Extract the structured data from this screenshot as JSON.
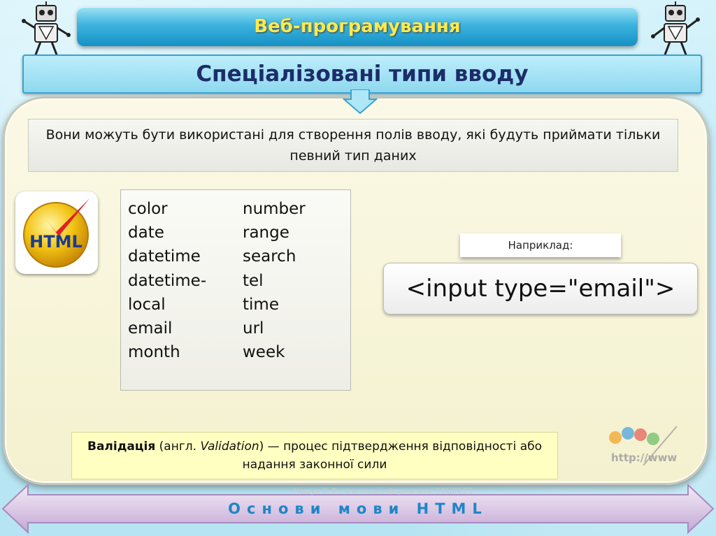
{
  "header": {
    "title": "Веб-програмування"
  },
  "slide": {
    "heading": "Спеціалізовані типи вводу",
    "description": "Вони можуть бути використані для створення полів вводу, які будуть приймати тільки певний тип даних",
    "logo_text": "HTML",
    "types_col1": [
      "color",
      "date",
      "datetime",
      "datetime-",
      "local",
      "email",
      "month"
    ],
    "types_col2": [
      "number",
      "range",
      "search",
      "tel",
      "time",
      "url",
      "week"
    ],
    "example_label": "Наприклад:",
    "example_code": "<input type=\"email\">",
    "validation": {
      "term": "Валідація",
      "pre": " (англ. ",
      "foreign": "Validation",
      "post": ") — процес підтвердження відповідності або надання законної сили"
    },
    "http_logo_text": "http://www"
  },
  "footer": {
    "author": "Чашук О.Ф., вчитель інформатики ЗОШ№23",
    "title": "Основи мови HTML"
  },
  "colors": {
    "title_yellow": "#ffe94d",
    "heading_navy": "#1c2d6a",
    "footer_blue": "#1e86c8",
    "validation_bg": "#ffffc2"
  }
}
